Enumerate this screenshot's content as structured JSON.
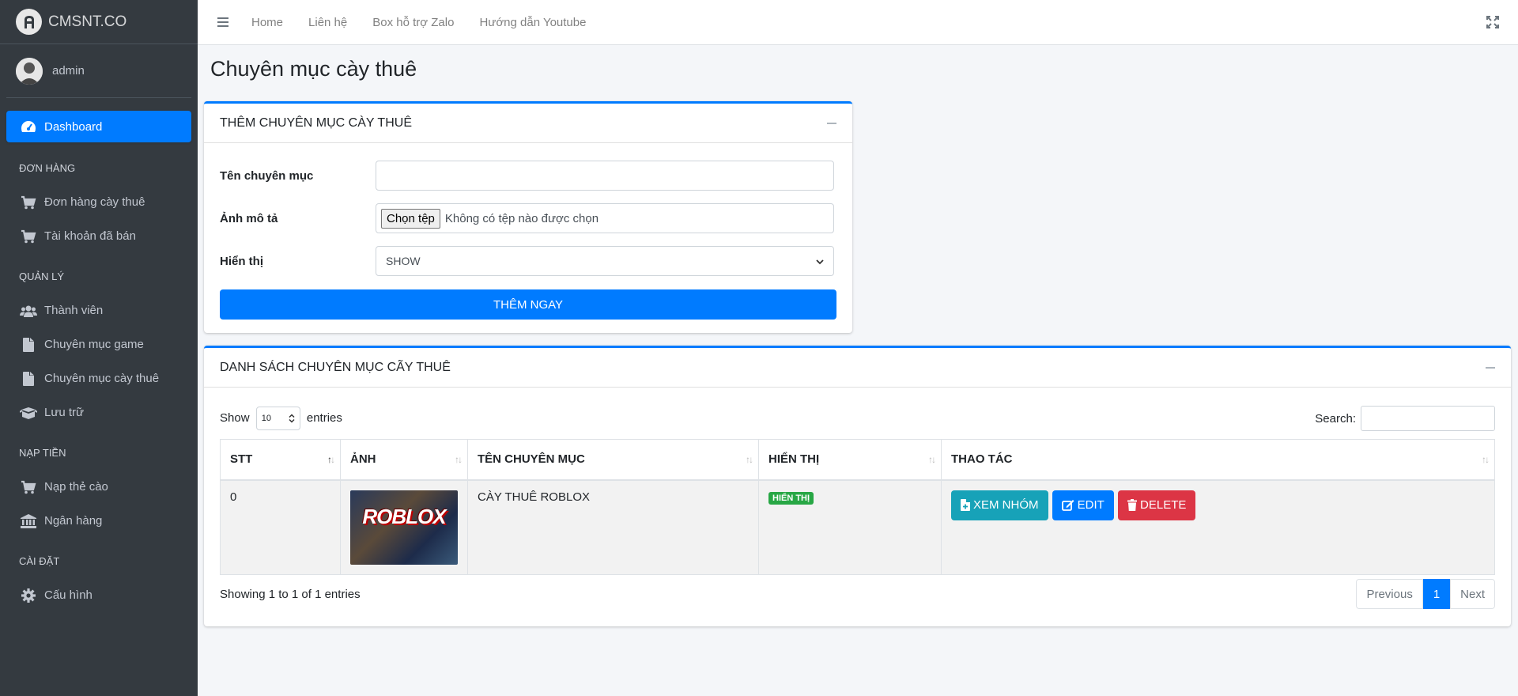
{
  "brand": {
    "name": "CMSNT.CO"
  },
  "user": {
    "name": "admin"
  },
  "sidebar": {
    "dashboard": "Dashboard",
    "sections": [
      {
        "header": "ĐƠN HÀNG",
        "items": [
          {
            "label": "Đơn hàng cày thuê",
            "icon": "cart-icon"
          },
          {
            "label": "Tài khoản đã bán",
            "icon": "cart-icon"
          }
        ]
      },
      {
        "header": "QUẢN LÝ",
        "items": [
          {
            "label": "Thành viên",
            "icon": "users-icon"
          },
          {
            "label": "Chuyên mục game",
            "icon": "file-icon"
          },
          {
            "label": "Chuyên mục cày thuê",
            "icon": "file-icon"
          },
          {
            "label": "Lưu trữ",
            "icon": "box-icon"
          }
        ]
      },
      {
        "header": "NẠP TIỀN",
        "items": [
          {
            "label": "Nạp thẻ cào",
            "icon": "cart-icon"
          },
          {
            "label": "Ngân hàng",
            "icon": "bank-icon"
          }
        ]
      },
      {
        "header": "CÀI ĐẶT",
        "items": [
          {
            "label": "Cấu hình",
            "icon": "gear-icon"
          }
        ]
      }
    ]
  },
  "topnav": {
    "links": [
      "Home",
      "Liên hệ",
      "Box hỗ trợ Zalo",
      "Hướng dẫn Youtube"
    ]
  },
  "page": {
    "title": "Chuyên mục cày thuê"
  },
  "add_card": {
    "title": "THÊM CHUYÊN MỤC CÀY THUÊ",
    "name_label": "Tên chuyên mục",
    "name_value": "",
    "image_label": "Ảnh mô tả",
    "file_button": "Chọn tệp",
    "file_status": "Không có tệp nào được chọn",
    "display_label": "Hiển thị",
    "display_value": "SHOW",
    "submit": "THÊM NGAY"
  },
  "list_card": {
    "title": "DANH SÁCH CHUYÊN MỤC CÃY THUÊ",
    "show_label": "Show",
    "entries_value": "10",
    "entries_label": "entries",
    "search_label": "Search:",
    "columns": [
      "STT",
      "ẢNH",
      "TÊN CHUYÊN MỤC",
      "HIỂN THỊ",
      "THAO TÁC"
    ],
    "rows": [
      {
        "stt": "0",
        "image_text": "ROBLOX",
        "name": "CÀY THUÊ ROBLOX",
        "status": "HIỂN THỊ"
      }
    ],
    "actions": {
      "view": "XEM NHÓM",
      "edit": "EDIT",
      "delete": "DELETE"
    },
    "info": "Showing 1 to 1 of 1 entries",
    "pagination": {
      "prev": "Previous",
      "page": "1",
      "next": "Next"
    }
  },
  "colors": {
    "sidebar": "#343a40",
    "primary": "#007bff",
    "info": "#17a2b8",
    "danger": "#dc3545",
    "success": "#28a745"
  }
}
